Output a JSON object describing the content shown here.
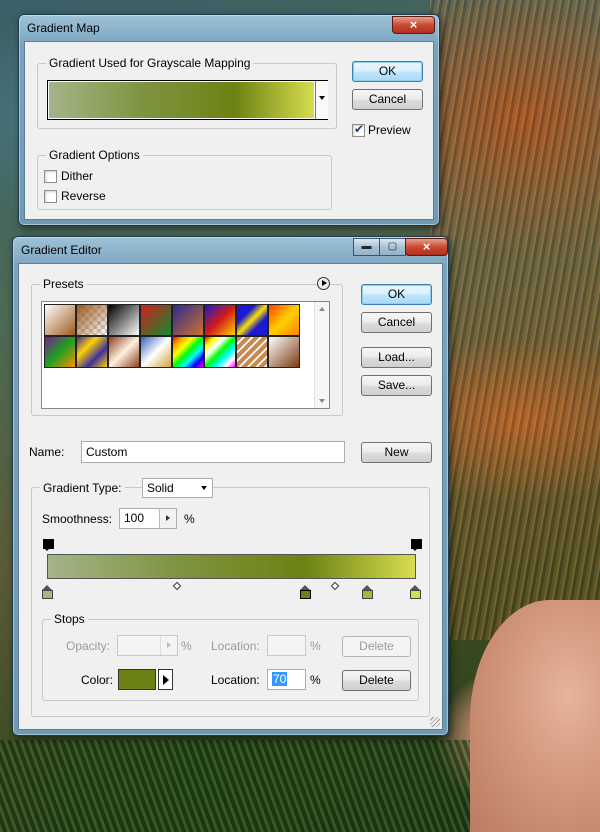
{
  "gradient_map": {
    "title": "Gradient Map",
    "close_icon": "×",
    "gradient_group_label": "Gradient Used for Grayscale Mapping",
    "ok_label": "OK",
    "cancel_label": "Cancel",
    "preview_label": "Preview",
    "preview_checked": true,
    "options_group_label": "Gradient Options",
    "dither_label": "Dither",
    "reverse_label": "Reverse"
  },
  "gradient_editor": {
    "title": "Gradient Editor",
    "presets_label": "Presets",
    "ok_label": "OK",
    "cancel_label": "Cancel",
    "load_label": "Load...",
    "save_label": "Save...",
    "name_label": "Name:",
    "name_value": "Custom",
    "new_label": "New",
    "gradient_type_label": "Gradient Type:",
    "gradient_type_value": "Solid",
    "smoothness_label": "Smoothness:",
    "smoothness_value": "100",
    "percent": "%",
    "stops_label": "Stops",
    "opacity_label": "Opacity:",
    "opacity_location_label": "Location:",
    "delete_label": "Delete",
    "color_label": "Color:",
    "color_location_label": "Location:",
    "color_location_value": "70",
    "stop_color": "#6c8212"
  }
}
